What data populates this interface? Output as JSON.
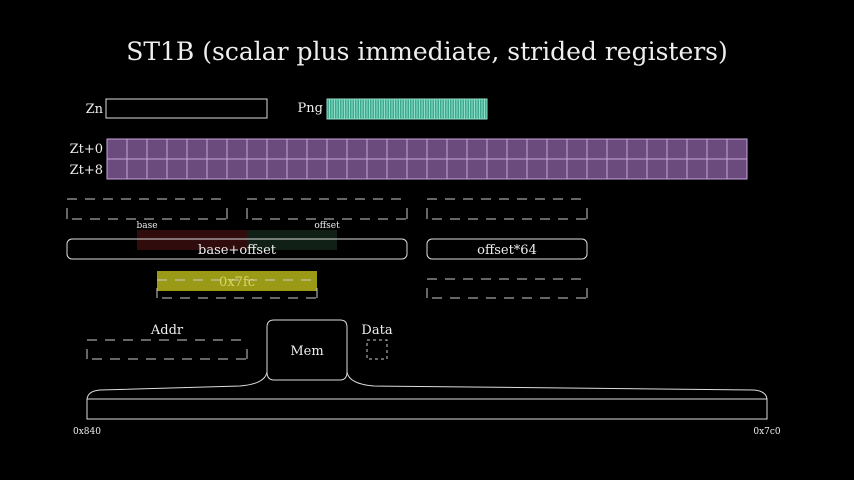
{
  "title": "ST1B (scalar plus immediate, strided registers)",
  "labels": {
    "zn": "Zn",
    "png": "Png",
    "zt0": "Zt+0",
    "zt8": "Zt+8",
    "base": "base",
    "offset": "offset",
    "base_plus_offset": "base+offset",
    "offset_times": "offset*64",
    "addr_value": "0x7fc",
    "addr": "Addr",
    "mem": "Mem",
    "data": "Data",
    "mem_start": "0x840",
    "mem_end": "0x7c0"
  },
  "colors": {
    "register_fill": "#6b4a7e",
    "register_stroke": "#c8a6dc",
    "predicate_fill": "#3fa88f",
    "predicate_stroke": "#8fe0c8",
    "addr_highlight": "#b5b51a",
    "base_tint": "#5a1616",
    "offset_tint": "#1d3a2a"
  },
  "register_lanes": 32,
  "predicate_lanes": 64
}
